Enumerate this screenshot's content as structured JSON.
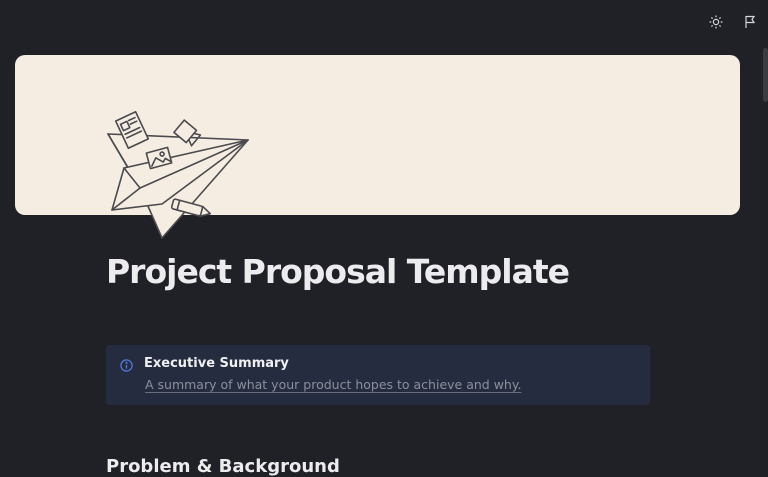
{
  "toolbar": {
    "icons": [
      "sun-icon",
      "flag-icon"
    ]
  },
  "page": {
    "title": "Project Proposal Template"
  },
  "callout": {
    "icon": "info-icon",
    "title": "Executive Summary",
    "description": "A summary of what your product hopes to achieve and why."
  },
  "sections": {
    "next_heading": "Problem & Background"
  },
  "colors": {
    "background": "#202126",
    "banner": "#f6ede2",
    "callout_bg": "#262c40",
    "accent": "#4f7fe0"
  }
}
